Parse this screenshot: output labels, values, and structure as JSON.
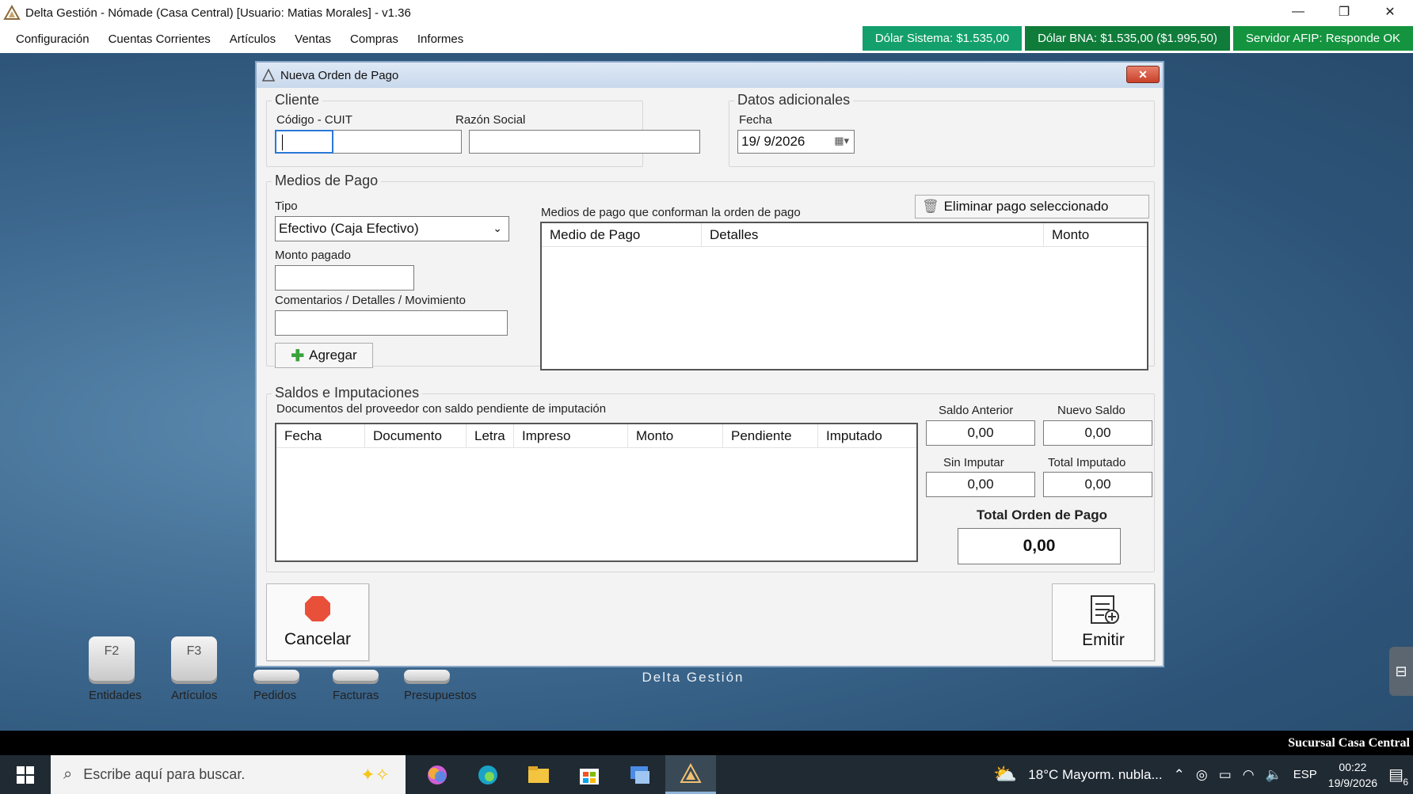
{
  "window": {
    "title": "Delta Gestión - Nómade (Casa Central) [Usuario: Matias  Morales] - v1.36",
    "minimize": "—",
    "restore": "❐",
    "close": "✕"
  },
  "menu": [
    "Configuración",
    "Cuentas Corrientes",
    "Artículos",
    "Ventas",
    "Compras",
    "Informes"
  ],
  "status": {
    "dolar_sistema": "Dólar Sistema: $1.535,00",
    "dolar_bna": "Dólar BNA: $1.535,00 ($1.995,50)",
    "afip": "Servidor AFIP:  Responde OK"
  },
  "dialog": {
    "title": "Nueva Orden de Pago",
    "close": "✕",
    "cliente": {
      "title": "Cliente",
      "codigo_label": "Código - CUIT",
      "razon_label": "Razón Social",
      "codigo_value": "",
      "razon_value": ""
    },
    "datos": {
      "title": "Datos adicionales",
      "fecha_label": "Fecha",
      "fecha_value": "19/  9/2026"
    },
    "medios": {
      "title": "Medios de Pago",
      "tipo_label": "Tipo",
      "tipo_value": "Efectivo (Caja Efectivo)",
      "monto_label": "Monto pagado",
      "comentarios_label": "Comentarios / Detalles / Movimiento",
      "agregar": "Agregar",
      "lista_label": "Medios de pago que conforman la orden de pago",
      "eliminar": "Eliminar pago seleccionado",
      "columns": [
        "Medio de Pago",
        "Detalles",
        "Monto"
      ]
    },
    "saldos": {
      "title": "Saldos e Imputaciones",
      "docs_label": "Documentos del proveedor con saldo pendiente de imputación",
      "columns": [
        "Fecha",
        "Documento",
        "Letra",
        "Impreso",
        "Monto",
        "Pendiente",
        "Imputado"
      ],
      "saldo_anterior_label": "Saldo Anterior",
      "saldo_anterior": "0,00",
      "nuevo_saldo_label": "Nuevo Saldo",
      "nuevo_saldo": "0,00",
      "sin_imputar_label": "Sin Imputar",
      "sin_imputar": "0,00",
      "total_imputado_label": "Total Imputado",
      "total_imputado": "0,00",
      "total_orden_label": "Total Orden de Pago",
      "total_orden": "0,00"
    },
    "cancelar": "Cancelar",
    "emitir": "Emitir"
  },
  "shortcuts": [
    {
      "key": "F2",
      "label": "Entidades"
    },
    {
      "key": "F3",
      "label": "Artículos"
    },
    {
      "key": "",
      "label": "Pedidos"
    },
    {
      "key": "",
      "label": "Facturas"
    },
    {
      "key": "",
      "label": "Presupuestos"
    }
  ],
  "brand": "Delta Gestión",
  "sucursal": "Sucursal Casa Central",
  "taskbar": {
    "search_placeholder": "Escribe aquí para buscar.",
    "weather": "18°C  Mayorm. nubla...",
    "lang": "ESP",
    "time": "00:22",
    "date": "19/9/2026",
    "notifications": "6"
  },
  "colors": {
    "badge_teal": "#13a06c",
    "badge_green": "#0f7c3a",
    "desktop": "#3f6a91",
    "dialog_bg": "#f3f3f3",
    "cancel_red": "#e8503a"
  }
}
